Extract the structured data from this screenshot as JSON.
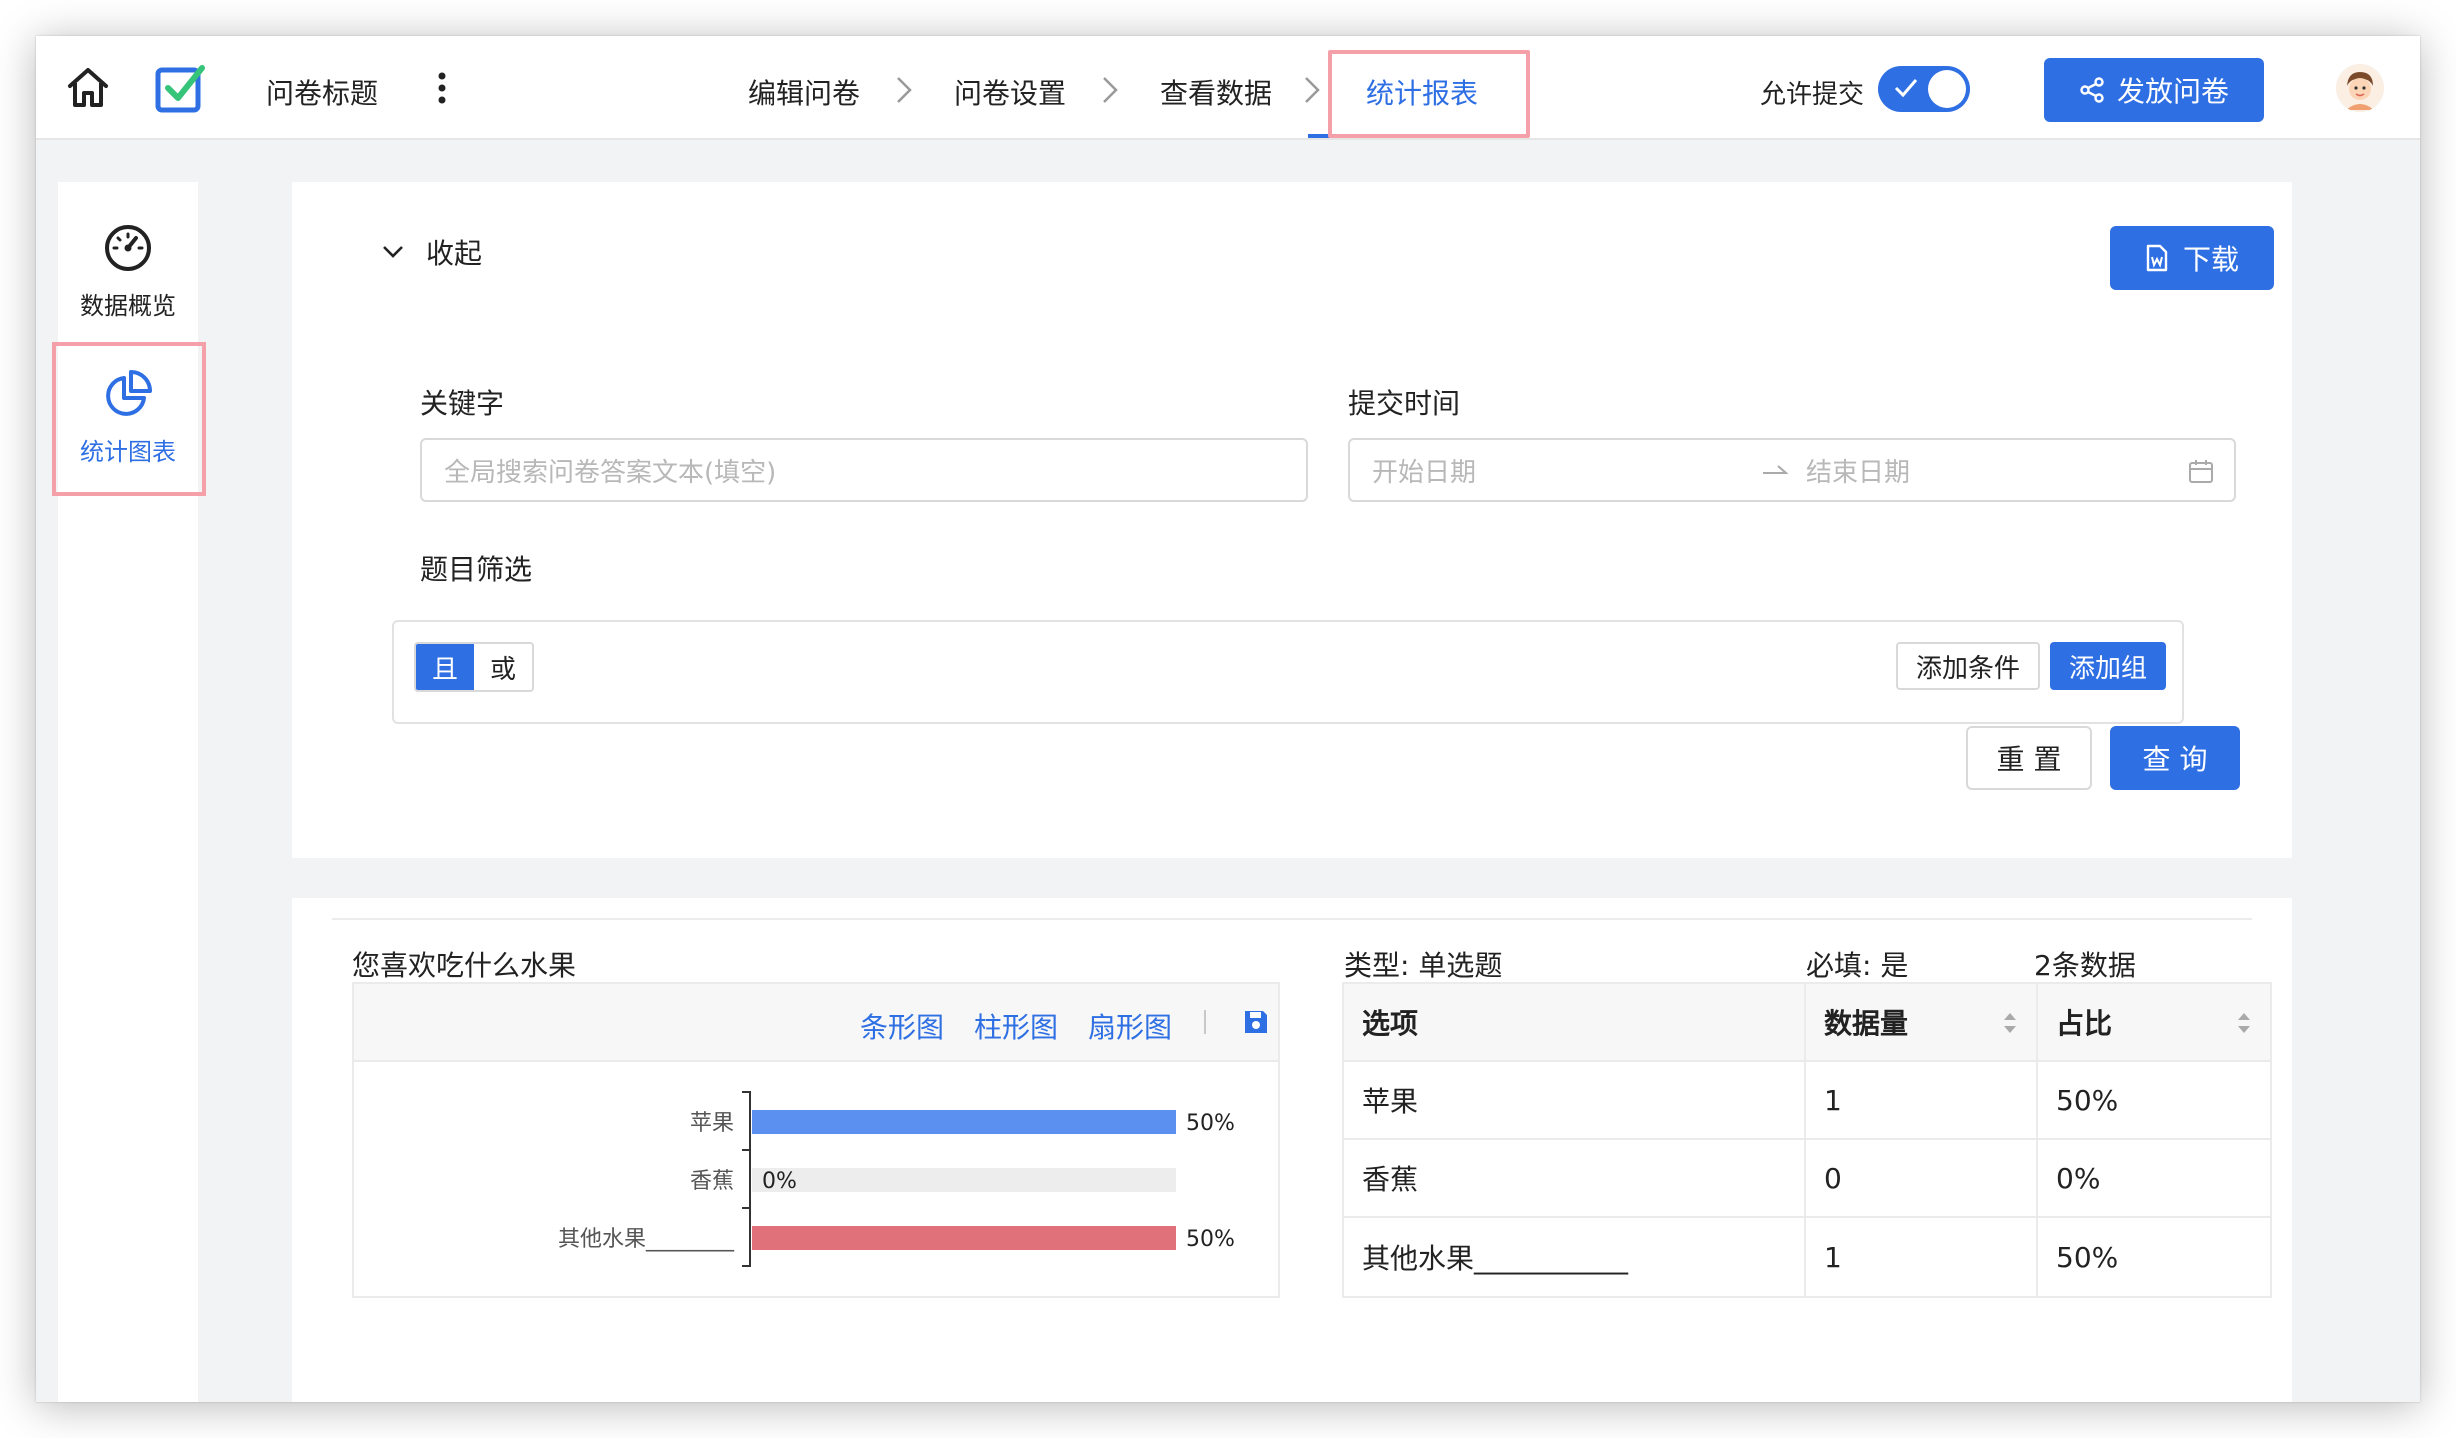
{
  "header": {
    "survey_title": "问卷标题",
    "steps": [
      "编辑问卷",
      "问卷设置",
      "查看数据",
      "统计报表"
    ],
    "allow_submit_label": "允许提交",
    "publish_label": "发放问卷"
  },
  "sidebar": {
    "items": [
      {
        "label": "数据概览",
        "icon": "gauge-icon"
      },
      {
        "label": "统计图表",
        "icon": "pie-chart-icon"
      }
    ]
  },
  "filters": {
    "collapse_label": "收起",
    "download_label": "下载",
    "keyword_label": "关键字",
    "keyword_placeholder": "全局搜索问卷答案文本(填空)",
    "time_label": "提交时间",
    "start_placeholder": "开始日期",
    "end_placeholder": "结束日期",
    "question_filter_label": "题目筛选",
    "logic_and": "且",
    "logic_or": "或",
    "add_condition_label": "添加条件",
    "add_group_label": "添加组",
    "reset_label": "重 置",
    "query_label": "查 询"
  },
  "question": {
    "title": "您喜欢吃什么水果",
    "chart_types": [
      "条形图",
      "柱形图",
      "扇形图"
    ],
    "type_label": "类型: 单选题",
    "required_label": "必填: 是",
    "count_label": "2条数据"
  },
  "table": {
    "headers": [
      "选项",
      "数据量",
      "占比"
    ],
    "rows": [
      [
        "苹果",
        "1",
        "50%"
      ],
      [
        "香蕉",
        "0",
        "0%"
      ],
      [
        "其他水果___________",
        "1",
        "50%"
      ]
    ]
  },
  "chart_data": {
    "type": "bar",
    "orientation": "horizontal",
    "categories": [
      "苹果",
      "香蕉",
      "其他水果________"
    ],
    "values": [
      50,
      0,
      50
    ],
    "value_labels": [
      "50%",
      "0%",
      "50%"
    ],
    "xlim": [
      0,
      50
    ],
    "colors": [
      "#5b8ff0",
      "#e0707a"
    ],
    "grid": false
  },
  "colors": {
    "accent": "#2f6fe4",
    "highlight_border": "#f5a0a8"
  }
}
